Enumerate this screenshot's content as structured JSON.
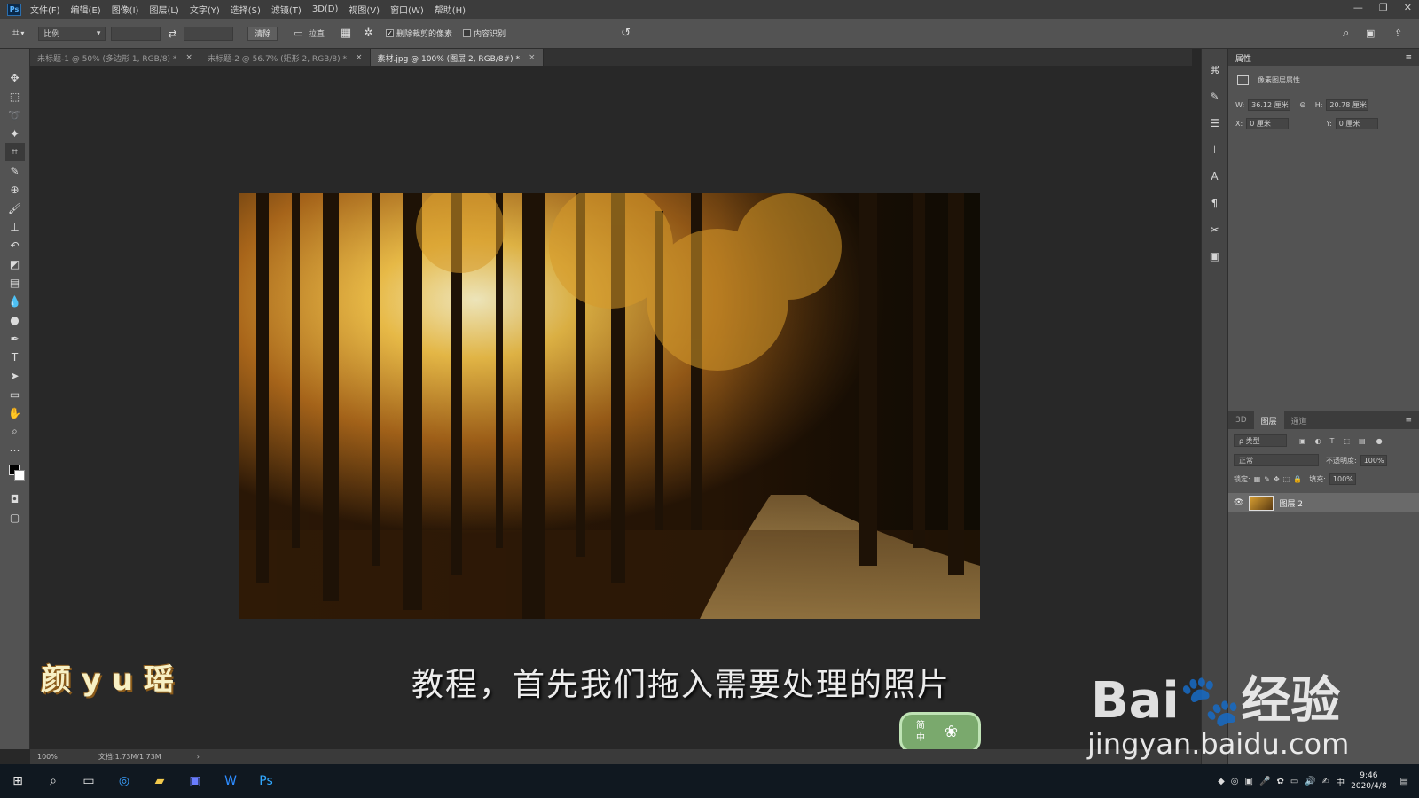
{
  "app": {
    "logo": "Ps"
  },
  "menu": [
    "文件(F)",
    "编辑(E)",
    "图像(I)",
    "图层(L)",
    "文字(Y)",
    "选择(S)",
    "滤镜(T)",
    "3D(D)",
    "视图(V)",
    "窗口(W)",
    "帮助(H)"
  ],
  "window_controls": [
    "—",
    "❐",
    "✕"
  ],
  "options": {
    "ratio_label": "比例",
    "clear_label": "清除",
    "straighten_label": "拉直",
    "delete_cropped_label": "删除裁剪的像素",
    "content_aware_label": "内容识别"
  },
  "tabs": [
    {
      "label": "未标题-1 @ 50% (多边形 1, RGB/8) *",
      "active": false
    },
    {
      "label": "未标题-2 @ 56.7% (矩形 2, RGB/8) *",
      "active": false
    },
    {
      "label": "素材.jpg @ 100% (图层 2, RGB/8#) *",
      "active": true
    }
  ],
  "canvas": {
    "subtitle": "教程，首先我们拖入需要处理的照片",
    "watermark_name": "颜 y u 瑶",
    "ime": {
      "line1": "简",
      "line2": "中"
    }
  },
  "status": {
    "zoom": "100%",
    "doc": "文档:1.73M/1.73M"
  },
  "properties": {
    "title": "属性",
    "subtitle": "像素图层属性",
    "w_label": "W:",
    "w_value": "36.12 厘米",
    "h_label": "H:",
    "h_value": "20.78 厘米",
    "x_label": "X:",
    "x_value": "0 厘米",
    "y_label": "Y:",
    "y_value": "0 厘米"
  },
  "layers": {
    "tabs": [
      "3D",
      "图层",
      "通道"
    ],
    "filter_label": "ρ 类型",
    "blend_mode": "正常",
    "opacity_label": "不透明度:",
    "opacity_value": "100%",
    "lock_label": "锁定:",
    "fill_label": "填充:",
    "fill_value": "100%",
    "layer_name": "图层 2"
  },
  "branding": {
    "logo_text": "Bai🐾经验",
    "url": "jingyan.baidu.com"
  },
  "taskbar": {
    "time": "9:46",
    "date": "2020/4/8",
    "ime": "中"
  }
}
